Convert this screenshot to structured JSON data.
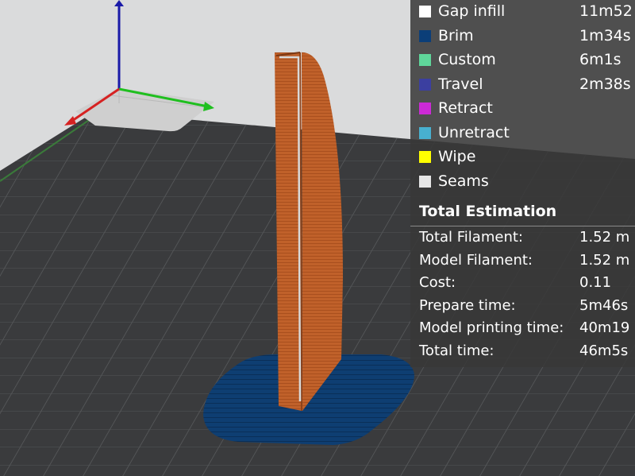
{
  "colors": {
    "background": "#dadbdc",
    "bed": "#3a3b3d",
    "bed_grid": "#585a5c",
    "print_area_corner": "#cfcfcf",
    "model": "#c0612a",
    "model_shadow": "#8f4218",
    "brim": "#0e3e72",
    "axis_x": "#d62222",
    "axis_y": "#1fbf1f",
    "axis_z": "#1a1aa8",
    "legend_bg": "#383838"
  },
  "legend": {
    "feature_types": [
      {
        "label": "Gap infill",
        "time": "11m52",
        "color": "#ffffff"
      },
      {
        "label": "Brim",
        "time": "1m34s",
        "color": "#0b3e78"
      },
      {
        "label": "Custom",
        "time": "6m1s",
        "color": "#5fd69a"
      },
      {
        "label": "Travel",
        "time": "2m38s",
        "color": "#3b3fa0"
      },
      {
        "label": "Retract",
        "time": "",
        "color": "#cc2ad6"
      },
      {
        "label": "Unretract",
        "time": "",
        "color": "#48b0d0"
      },
      {
        "label": "Wipe",
        "time": "",
        "color": "#ffff00"
      },
      {
        "label": "Seams",
        "time": "",
        "color": "#e6e6e6"
      }
    ],
    "summary": {
      "title": "Total Estimation",
      "rows": [
        {
          "label": "Total Filament:",
          "value": "1.52 m"
        },
        {
          "label": "Model Filament:",
          "value": "1.52 m"
        },
        {
          "label": "Cost:",
          "value": "0.11"
        },
        {
          "label": "Prepare time:",
          "value": "5m46s"
        },
        {
          "label": "Model printing time:",
          "value": "40m19"
        },
        {
          "label": "Total time:",
          "value": "46m5s"
        }
      ]
    }
  }
}
